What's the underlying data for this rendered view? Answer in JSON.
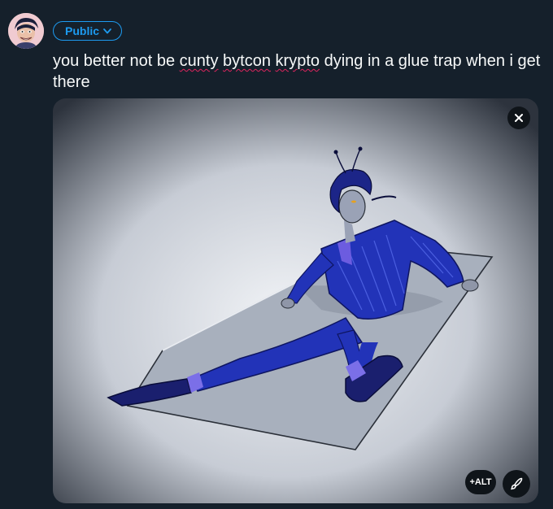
{
  "composer": {
    "audience_label": "Public",
    "text_parts": [
      {
        "text": "you better not be ",
        "misspelled": false
      },
      {
        "text": "cunty",
        "misspelled": true
      },
      {
        "text": " ",
        "misspelled": false
      },
      {
        "text": "bytcon",
        "misspelled": true
      },
      {
        "text": " ",
        "misspelled": false
      },
      {
        "text": "krypto",
        "misspelled": true
      },
      {
        "text": " dying in a glue trap when i get there",
        "misspelled": false
      }
    ]
  },
  "media": {
    "alt_label": "+ALT",
    "remove_icon": "close-icon",
    "edit_icon": "brush-icon"
  },
  "colors": {
    "background": "#15202b",
    "accent": "#1d9bf0",
    "text": "#f7f9f9",
    "spellcheck": "#e0245e"
  }
}
